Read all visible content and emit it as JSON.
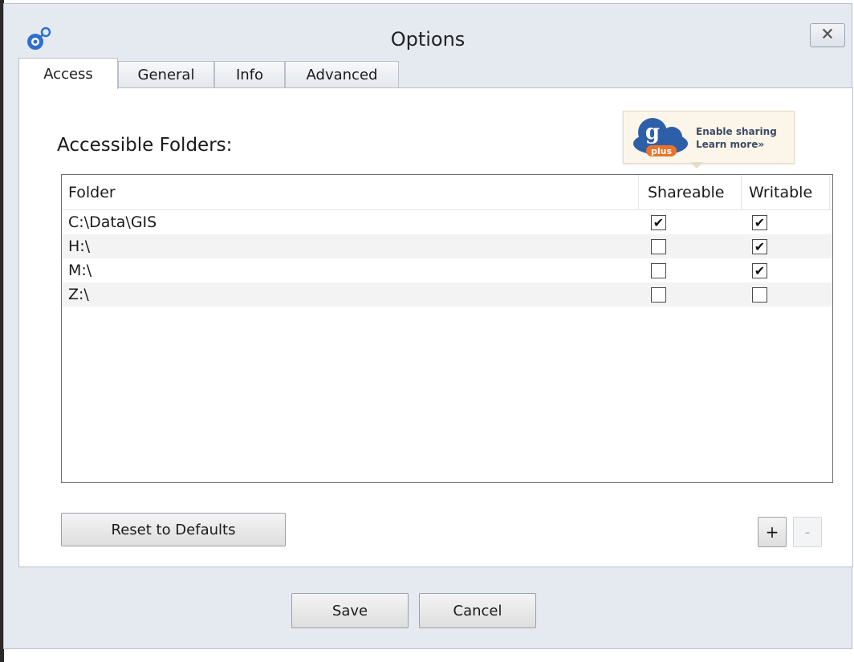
{
  "window": {
    "title": "Options",
    "close_label": "🗙"
  },
  "tabs": [
    {
      "label": "Access",
      "active": true
    },
    {
      "label": "General",
      "active": false
    },
    {
      "label": "Info",
      "active": false
    },
    {
      "label": "Advanced",
      "active": false
    }
  ],
  "access": {
    "heading": "Accessible Folders:",
    "promo": {
      "logo_text": "g",
      "logo_badge": "plus",
      "line1": "Enable sharing",
      "line2": "Learn more»"
    },
    "table": {
      "columns": [
        "Folder",
        "Shareable",
        "Writable"
      ],
      "rows": [
        {
          "folder": "C:\\Data\\GIS",
          "shareable": true,
          "writable": true
        },
        {
          "folder": "H:\\",
          "shareable": false,
          "writable": true
        },
        {
          "folder": "M:\\",
          "shareable": false,
          "writable": true
        },
        {
          "folder": "Z:\\",
          "shareable": false,
          "writable": false
        }
      ]
    },
    "reset_label": "Reset to Defaults",
    "add_label": "+",
    "remove_label": "-"
  },
  "footer": {
    "save_label": "Save",
    "cancel_label": "Cancel"
  },
  "colors": {
    "window_bg": "#e5eaf1",
    "panel_bg": "#ffffff",
    "alt_row": "#f3f3f4",
    "promo_blue": "#2d5fa8",
    "promo_orange": "#e8742a"
  },
  "icons": {
    "app": "gear-sphere-icon",
    "close": "close-icon",
    "checkbox_checked": "checkmark-icon"
  }
}
